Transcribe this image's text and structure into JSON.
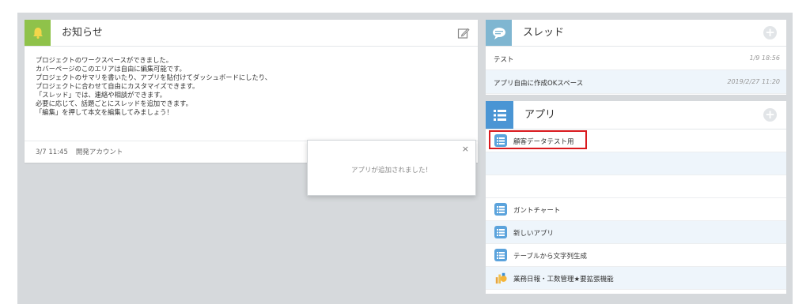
{
  "notice": {
    "title": "お知らせ",
    "lines": [
      "プロジェクトのワークスペースができました。",
      "カバーページのこのエリアは自由に編集可能です。",
      "プロジェクトのサマリを書いたり、アプリを貼付けてダッシュボードにしたり、",
      "プロジェクトに合わせて自由にカスタマイズできます。",
      "「スレッド」では、連絡や相談ができます。",
      "必要に応じて、話題ごとにスレッドを追加できます。",
      "「編集」を押して本文を編集してみましょう！"
    ],
    "timestamp": "3/7 11:45",
    "author": "開発アカウント"
  },
  "popup": {
    "close": "×",
    "message": "アプリが追加されました！"
  },
  "thread": {
    "title": "スレッド",
    "add": "+",
    "items": [
      {
        "title": "テスト",
        "date": "1/9 18:56"
      },
      {
        "title": "アプリ自由に作成OKスペース",
        "date": "2019/2/27 11:20"
      }
    ]
  },
  "apps": {
    "title": "アプリ",
    "add": "+",
    "items": [
      {
        "label": "顧客データテスト用",
        "icon": "list-app-icon"
      },
      {
        "label": "",
        "icon": ""
      },
      {
        "label": "",
        "icon": ""
      },
      {
        "label": "ガントチャート",
        "icon": "list-app-icon"
      },
      {
        "label": "新しいアプリ",
        "icon": "list-app-icon"
      },
      {
        "label": "テーブルから文字列生成",
        "icon": "list-app-icon"
      },
      {
        "label": "業務日報・工数管理★要拡張機能",
        "icon": "report-app-icon"
      }
    ]
  },
  "colors": {
    "notice_icon_bg": "#8fc24a",
    "thread_icon_bg": "#7fb6d1",
    "apps_icon_bg": "#4a95d4",
    "highlight": "#d9191e"
  }
}
